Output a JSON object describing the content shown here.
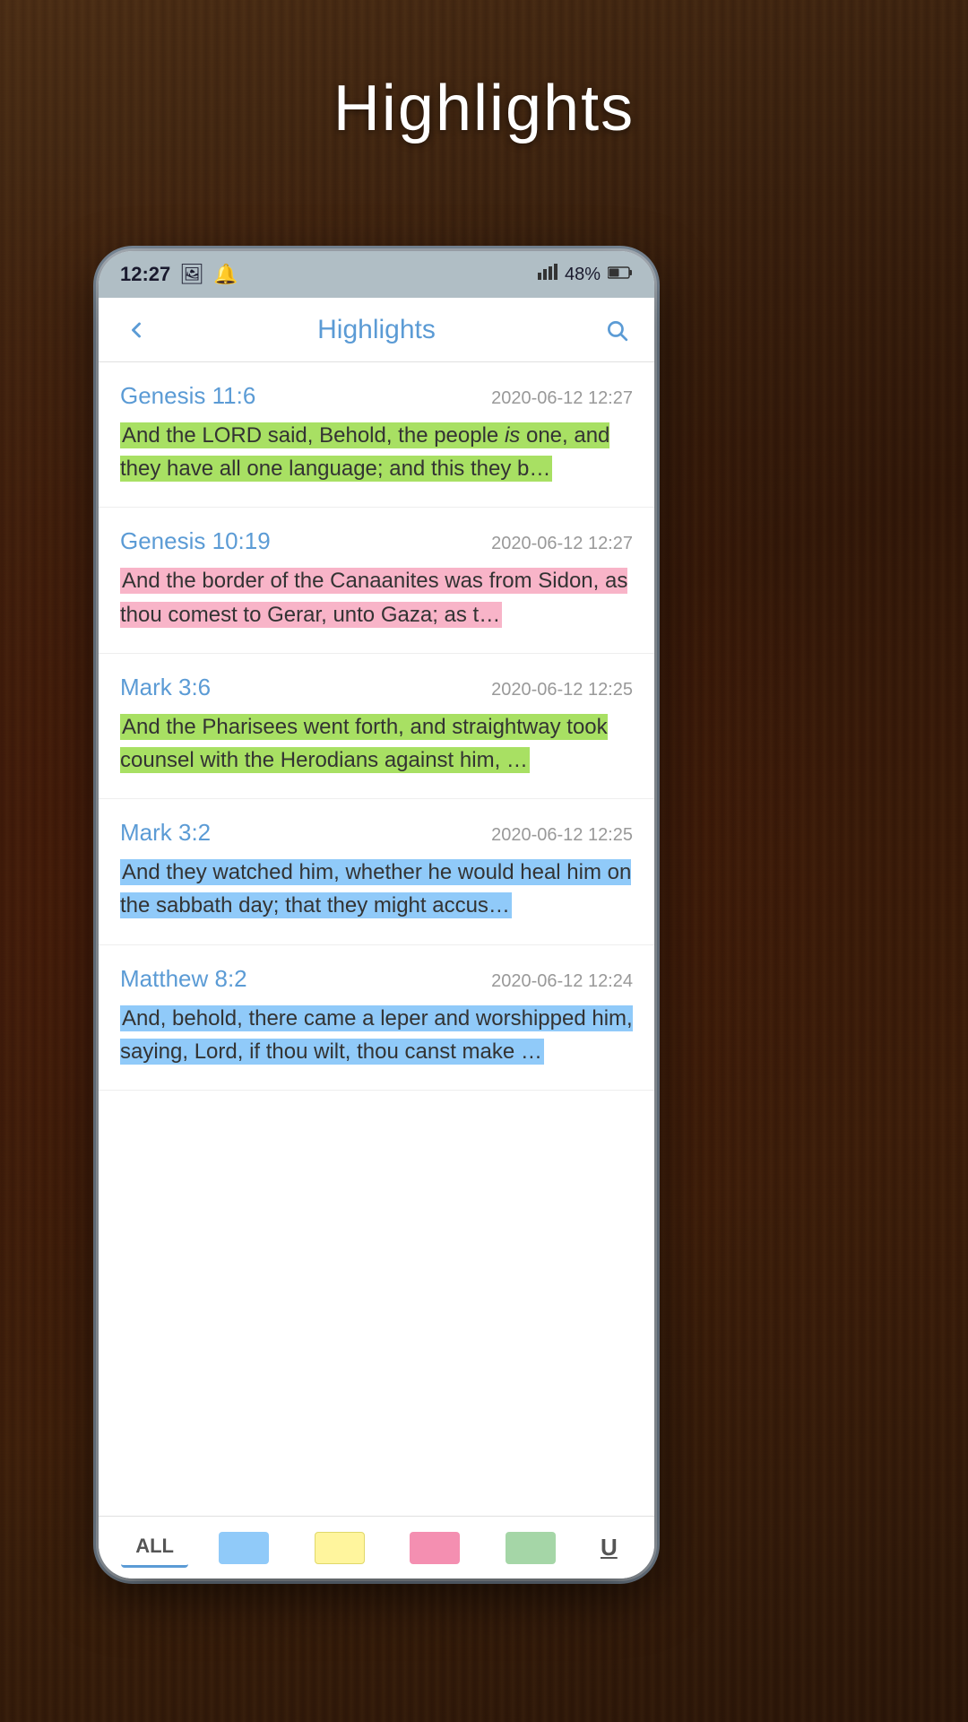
{
  "page": {
    "title": "Highlights",
    "background_color": "#3a2010"
  },
  "status_bar": {
    "time": "12:27",
    "battery": "48%",
    "signal": "●●●",
    "icons": [
      "🖼",
      "🔔"
    ]
  },
  "header": {
    "title": "Highlights",
    "back_label": "←",
    "search_label": "🔍"
  },
  "highlights": [
    {
      "reference": "Genesis 11:6",
      "date": "2020-06-12 12:27",
      "text": "And the LORD said, Behold, the people is one, and they have all one language; and this they b…",
      "highlight_color": "green"
    },
    {
      "reference": "Genesis 10:19",
      "date": "2020-06-12 12:27",
      "text": "And the border of the Canaanites was from Sidon, as thou comest to Gerar, unto Gaza; as t…",
      "highlight_color": "pink"
    },
    {
      "reference": "Mark 3:6",
      "date": "2020-06-12 12:25",
      "text": "And the Pharisees went forth, and straightway took counsel with the Herodians against him, …",
      "highlight_color": "green"
    },
    {
      "reference": "Mark 3:2",
      "date": "2020-06-12 12:25",
      "text": "And they watched him, whether he would heal him on the sabbath day; that they might accus…",
      "highlight_color": "blue"
    },
    {
      "reference": "Matthew 8:2",
      "date": "2020-06-12 12:24",
      "text": "And, behold, there came a leper and worshipped him, saying, Lord, if thou wilt, thou canst make …",
      "highlight_color": "blue"
    }
  ],
  "bottom_bar": {
    "tabs": [
      {
        "label": "ALL",
        "type": "text",
        "active": true
      },
      {
        "label": "",
        "type": "color",
        "color": "#90caf9"
      },
      {
        "label": "",
        "type": "color",
        "color": "#fff59d"
      },
      {
        "label": "",
        "type": "color",
        "color": "#f48fb1"
      },
      {
        "label": "",
        "type": "color",
        "color": "#a5d6a7"
      },
      {
        "label": "U",
        "type": "underline"
      }
    ]
  }
}
